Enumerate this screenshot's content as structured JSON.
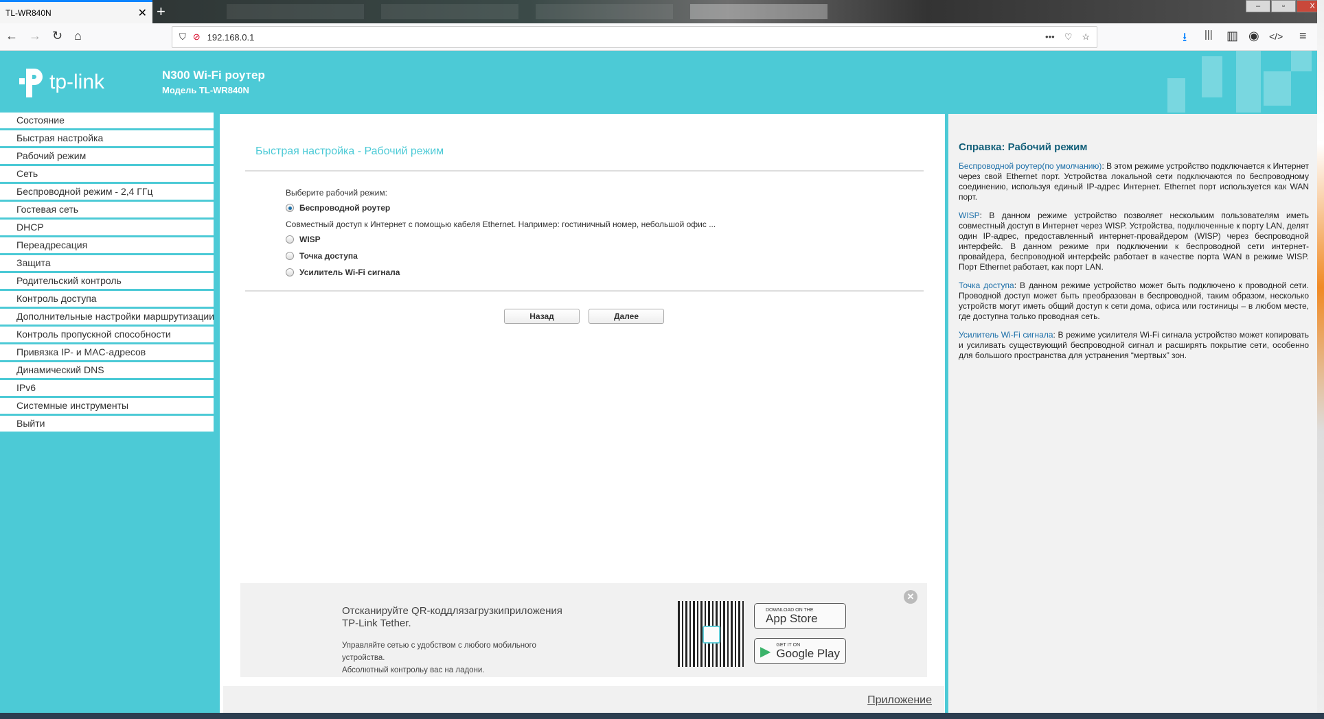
{
  "browser": {
    "tab_title": "TL-WR840N",
    "url": "192.168.0.1"
  },
  "header": {
    "logo_text": "tp-link",
    "title": "N300 Wi-Fi роутер",
    "model": "Модель TL-WR840N"
  },
  "sidebar": {
    "items": [
      "Состояние",
      "Быстрая настройка",
      "Рабочий режим",
      "Сеть",
      "Беспроводной режим - 2,4 ГГц",
      "Гостевая сеть",
      "DHCP",
      "Переадресация",
      "Защита",
      "Родительский контроль",
      "Контроль доступа",
      "Дополнительные настройки маршрутизации",
      "Контроль пропускной способности",
      "Привязка IP- и MAC-адресов",
      "Динамический DNS",
      "IPv6",
      "Системные инструменты",
      "Выйти"
    ]
  },
  "main": {
    "title": "Быстрая настройка - Рабочий режим",
    "mode_label": "Выберите рабочий режим:",
    "modes": [
      {
        "label": "Беспроводной роутер",
        "selected": true
      },
      {
        "label": "WISP",
        "selected": false
      },
      {
        "label": "Точка доступа",
        "selected": false
      },
      {
        "label": "Усилитель Wi-Fi сигнала",
        "selected": false
      }
    ],
    "description": "Совместный доступ к Интернет с помощью кабеля Ethernet. Например: гостиничный номер, небольшой офис ...",
    "back_label": "Назад",
    "next_label": "Далее"
  },
  "banner": {
    "line1": "Отсканируйте QR-коддлязагрузкиприложения TP-Link Tether.",
    "line2": "Управляйте сетью с удобством с любого мобильного устройства.",
    "line3": "Абсолютный контрольу вас на ладони.",
    "appstore_small": "DOWNLOAD ON THE",
    "appstore": "App Store",
    "gplay_small": "GET IT ON",
    "gplay": "Google Play",
    "app_link": "Приложение"
  },
  "help": {
    "title": "Справка: Рабочий режим",
    "paragraphs": [
      {
        "key": "Беспроводной роутер(по умолчанию)",
        "text": ": В этом режиме устройство подключается к Интернет через свой Ethernet порт. Устройства локальной сети подключаются по беспроводному соединению, используя единый IP-адрес Интернет. Ethernet порт используется как WAN порт."
      },
      {
        "key": "WISP",
        "text": ": В данном режиме устройство позволяет нескольким пользователям иметь совместный доступ в Интернет через WISP. Устройства, подключенные к порту LAN, делят один IP-адрес, предоставленный интернет-провайдером (WISP) через беспроводной интерфейс. В данном режиме при подключении к беспроводной сети интернет-провайдера, беспроводной интерфейс работает в качестве порта WAN в режиме WISP. Порт Ethernet работает, как порт LAN."
      },
      {
        "key": "Точка доступа",
        "text": ": В данном режиме устройство может быть подключено к проводной сети. Проводной доступ может быть преобразован в беспроводной, таким образом, несколько устройств могут иметь общий доступ к сети дома, офиса или гостиницы – в любом месте, где доступна только проводная сеть."
      },
      {
        "key": "Усилитель Wi-Fi сигнала",
        "text": ": В режиме усилителя Wi-Fi сигнала устройство может копировать и усиливать существующий беспроводной сигнал и расширять покрытие сети, особенно для большого пространства для устранения “мертвых” зон."
      }
    ]
  },
  "colors": {
    "brand": "#4ccad6",
    "help_title": "#14607a",
    "help_key": "#1b6ea8"
  }
}
